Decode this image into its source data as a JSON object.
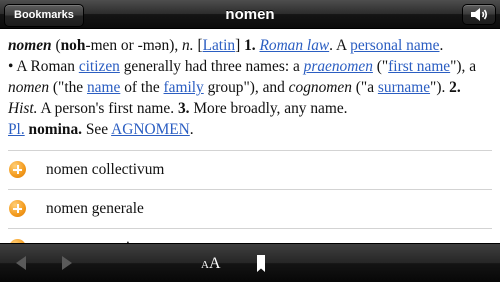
{
  "navbar": {
    "back_label": "Bookmarks",
    "title": "nomen",
    "speaker_icon": "speaker-icon"
  },
  "definition": {
    "headword": "nomen",
    "pron_bold": "noh",
    "pron_rest": "-men or -mən)",
    "pos": "n.",
    "etym_open": "[",
    "etym_lang": "Latin",
    "etym_close": "]",
    "sense1_num": "1.",
    "sense1_link": "Roman law",
    "sense1_a": ". A",
    "sense1_link2": "personal name",
    "sense1_dot": ".",
    "bullet_text_a": "• A Roman",
    "link_citizen": "citizen",
    "bullet_text_b": "generally had three names: a",
    "link_praenomen": "praenomen",
    "paren_open": "(\"",
    "link_first_name": "first name",
    "text_c": "\"), a",
    "nomen_italic": "nomen",
    "text_d": "(\"the",
    "link_name": "name",
    "text_e": "of the",
    "link_family": "family",
    "text_f": "group\"), and",
    "cognomen_italic": "cognomen",
    "text_g": "(\"a",
    "link_surname": "surname",
    "text_h": "\").",
    "sense2_num": "2.",
    "sense2_label": "Hist.",
    "sense2_text": "A person's first name.",
    "sense3_num": "3.",
    "sense3_text": "More broadly, any name.",
    "plural_abbrev": "Pl.",
    "plural_form": "nomina.",
    "see_text": "See",
    "see_link": "AGNOMEN",
    "see_end": "."
  },
  "related": [
    {
      "label": "nomen collectivum",
      "icon": "plus-circle-icon"
    },
    {
      "label": "nomen generale",
      "icon": "plus-circle-icon"
    },
    {
      "label": "nomen genericum",
      "icon": "plus-circle-icon"
    }
  ],
  "toolbar": {
    "back_icon": "left-arrow-icon",
    "forward_icon": "right-arrow-icon",
    "font_small": "A",
    "font_big": "A",
    "bookmark_icon": "bookmark-icon"
  },
  "colors": {
    "link": "#2b5ec2",
    "accent": "#f39a1c",
    "bar": "#1a1a1a"
  }
}
